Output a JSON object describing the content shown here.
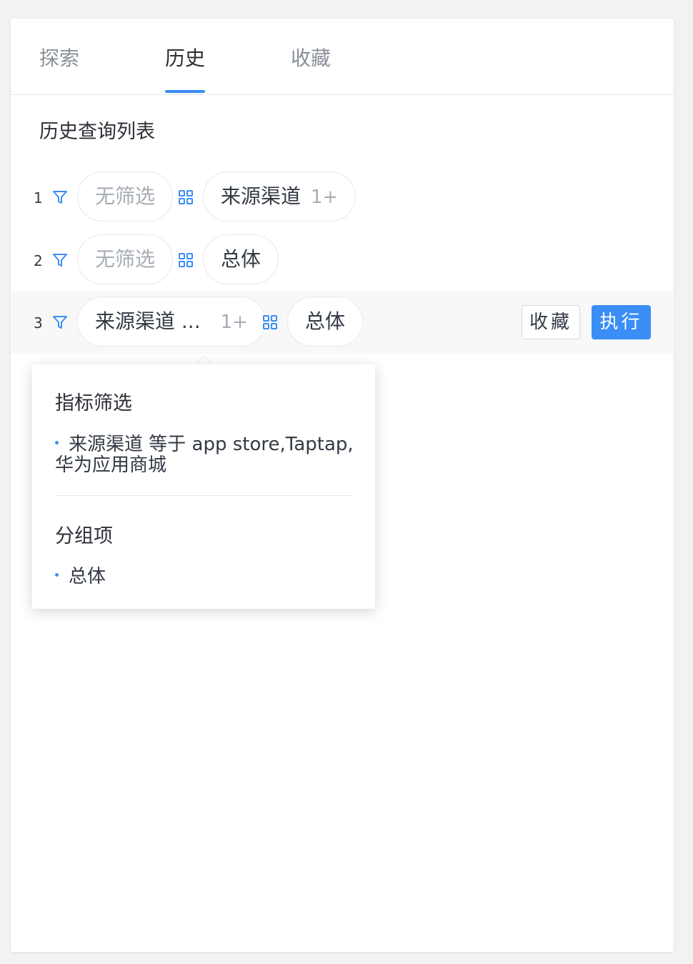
{
  "tabs": [
    {
      "label": "探索",
      "active": false
    },
    {
      "label": "历史",
      "active": true
    },
    {
      "label": "收藏",
      "active": false
    }
  ],
  "section_title": "历史查询列表",
  "rows": [
    {
      "num": "1",
      "filter": "无筛选",
      "group": "来源渠道",
      "group_extra": "1+"
    },
    {
      "num": "2",
      "filter": "无筛选",
      "group": "总体"
    },
    {
      "num": "3",
      "filter": "来源渠道 ...",
      "filter_extra": "1+",
      "group": "总体",
      "fav_label": "收藏",
      "run_label": "执行"
    }
  ],
  "popover": {
    "filter_title": "指标筛选",
    "filter_item": "来源渠道 等于 app store,Taptap,华为应用商城",
    "group_title": "分组项",
    "group_item": "总体"
  },
  "colors": {
    "accent": "#3a8ef6",
    "muted_text": "#a7adb5",
    "text": "#333a44"
  },
  "icons": {
    "filter": "filter-funnel-icon",
    "group": "grid-four-squares-icon"
  }
}
